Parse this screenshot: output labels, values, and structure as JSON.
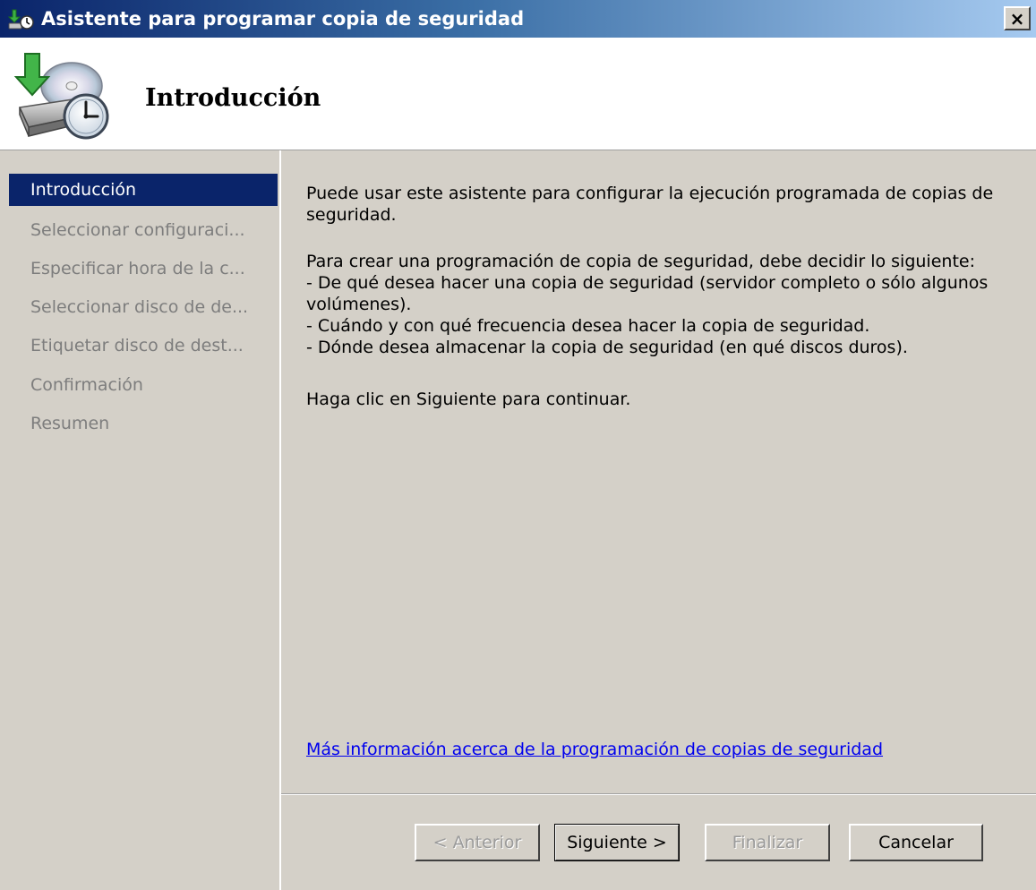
{
  "window": {
    "title": "Asistente para programar copia de seguridad",
    "close_label": "×"
  },
  "header": {
    "title": "Introducción",
    "icon": "backup-schedule-icon"
  },
  "sidebar": {
    "items": [
      {
        "label": "Introducción",
        "active": true
      },
      {
        "label": "Seleccionar configuraci...",
        "active": false
      },
      {
        "label": "Especificar hora de la c...",
        "active": false
      },
      {
        "label": "Seleccionar disco de de...",
        "active": false
      },
      {
        "label": "Etiquetar disco de dest...",
        "active": false
      },
      {
        "label": "Confirmación",
        "active": false
      },
      {
        "label": "Resumen",
        "active": false
      }
    ]
  },
  "main": {
    "intro": "Puede usar este asistente para configurar la ejecución programada de copias de seguridad.",
    "decide_heading": "Para crear una programación de copia de seguridad, debe decidir lo siguiente:",
    "decide_items": [
      "- De qué desea hacer una copia de seguridad (servidor completo o sólo algunos volúmenes).",
      "- Cuándo y con qué frecuencia desea hacer la copia de seguridad.",
      "- Dónde desea almacenar la copia de seguridad (en qué discos duros)."
    ],
    "continue_text": "Haga clic en Siguiente para continuar.",
    "more_info_link": "Más información acerca de la programación de copias de seguridad"
  },
  "buttons": {
    "previous": "< Anterior",
    "next": "Siguiente >",
    "finish": "Finalizar",
    "cancel": "Cancelar"
  },
  "colors": {
    "titlebar_start": "#0a246a",
    "titlebar_end": "#a6caf0",
    "selection": "#0a246a",
    "dialog_face": "#d4d0c8",
    "link": "#0000ee"
  }
}
